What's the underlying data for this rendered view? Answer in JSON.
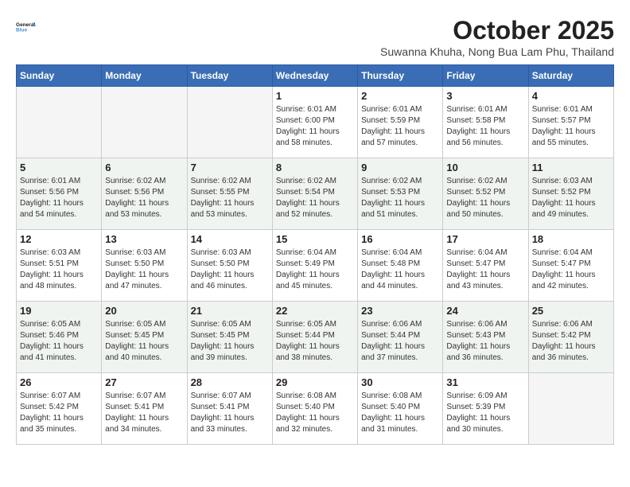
{
  "logo": {
    "line1": "General",
    "line2": "Blue"
  },
  "title": "October 2025",
  "subtitle": "Suwanna Khuha, Nong Bua Lam Phu, Thailand",
  "weekdays": [
    "Sunday",
    "Monday",
    "Tuesday",
    "Wednesday",
    "Thursday",
    "Friday",
    "Saturday"
  ],
  "weeks": [
    [
      {
        "day": "",
        "info": ""
      },
      {
        "day": "",
        "info": ""
      },
      {
        "day": "",
        "info": ""
      },
      {
        "day": "1",
        "info": "Sunrise: 6:01 AM\nSunset: 6:00 PM\nDaylight: 11 hours and 58 minutes."
      },
      {
        "day": "2",
        "info": "Sunrise: 6:01 AM\nSunset: 5:59 PM\nDaylight: 11 hours and 57 minutes."
      },
      {
        "day": "3",
        "info": "Sunrise: 6:01 AM\nSunset: 5:58 PM\nDaylight: 11 hours and 56 minutes."
      },
      {
        "day": "4",
        "info": "Sunrise: 6:01 AM\nSunset: 5:57 PM\nDaylight: 11 hours and 55 minutes."
      }
    ],
    [
      {
        "day": "5",
        "info": "Sunrise: 6:01 AM\nSunset: 5:56 PM\nDaylight: 11 hours and 54 minutes."
      },
      {
        "day": "6",
        "info": "Sunrise: 6:02 AM\nSunset: 5:56 PM\nDaylight: 11 hours and 53 minutes."
      },
      {
        "day": "7",
        "info": "Sunrise: 6:02 AM\nSunset: 5:55 PM\nDaylight: 11 hours and 53 minutes."
      },
      {
        "day": "8",
        "info": "Sunrise: 6:02 AM\nSunset: 5:54 PM\nDaylight: 11 hours and 52 minutes."
      },
      {
        "day": "9",
        "info": "Sunrise: 6:02 AM\nSunset: 5:53 PM\nDaylight: 11 hours and 51 minutes."
      },
      {
        "day": "10",
        "info": "Sunrise: 6:02 AM\nSunset: 5:52 PM\nDaylight: 11 hours and 50 minutes."
      },
      {
        "day": "11",
        "info": "Sunrise: 6:03 AM\nSunset: 5:52 PM\nDaylight: 11 hours and 49 minutes."
      }
    ],
    [
      {
        "day": "12",
        "info": "Sunrise: 6:03 AM\nSunset: 5:51 PM\nDaylight: 11 hours and 48 minutes."
      },
      {
        "day": "13",
        "info": "Sunrise: 6:03 AM\nSunset: 5:50 PM\nDaylight: 11 hours and 47 minutes."
      },
      {
        "day": "14",
        "info": "Sunrise: 6:03 AM\nSunset: 5:50 PM\nDaylight: 11 hours and 46 minutes."
      },
      {
        "day": "15",
        "info": "Sunrise: 6:04 AM\nSunset: 5:49 PM\nDaylight: 11 hours and 45 minutes."
      },
      {
        "day": "16",
        "info": "Sunrise: 6:04 AM\nSunset: 5:48 PM\nDaylight: 11 hours and 44 minutes."
      },
      {
        "day": "17",
        "info": "Sunrise: 6:04 AM\nSunset: 5:47 PM\nDaylight: 11 hours and 43 minutes."
      },
      {
        "day": "18",
        "info": "Sunrise: 6:04 AM\nSunset: 5:47 PM\nDaylight: 11 hours and 42 minutes."
      }
    ],
    [
      {
        "day": "19",
        "info": "Sunrise: 6:05 AM\nSunset: 5:46 PM\nDaylight: 11 hours and 41 minutes."
      },
      {
        "day": "20",
        "info": "Sunrise: 6:05 AM\nSunset: 5:45 PM\nDaylight: 11 hours and 40 minutes."
      },
      {
        "day": "21",
        "info": "Sunrise: 6:05 AM\nSunset: 5:45 PM\nDaylight: 11 hours and 39 minutes."
      },
      {
        "day": "22",
        "info": "Sunrise: 6:05 AM\nSunset: 5:44 PM\nDaylight: 11 hours and 38 minutes."
      },
      {
        "day": "23",
        "info": "Sunrise: 6:06 AM\nSunset: 5:44 PM\nDaylight: 11 hours and 37 minutes."
      },
      {
        "day": "24",
        "info": "Sunrise: 6:06 AM\nSunset: 5:43 PM\nDaylight: 11 hours and 36 minutes."
      },
      {
        "day": "25",
        "info": "Sunrise: 6:06 AM\nSunset: 5:42 PM\nDaylight: 11 hours and 36 minutes."
      }
    ],
    [
      {
        "day": "26",
        "info": "Sunrise: 6:07 AM\nSunset: 5:42 PM\nDaylight: 11 hours and 35 minutes."
      },
      {
        "day": "27",
        "info": "Sunrise: 6:07 AM\nSunset: 5:41 PM\nDaylight: 11 hours and 34 minutes."
      },
      {
        "day": "28",
        "info": "Sunrise: 6:07 AM\nSunset: 5:41 PM\nDaylight: 11 hours and 33 minutes."
      },
      {
        "day": "29",
        "info": "Sunrise: 6:08 AM\nSunset: 5:40 PM\nDaylight: 11 hours and 32 minutes."
      },
      {
        "day": "30",
        "info": "Sunrise: 6:08 AM\nSunset: 5:40 PM\nDaylight: 11 hours and 31 minutes."
      },
      {
        "day": "31",
        "info": "Sunrise: 6:09 AM\nSunset: 5:39 PM\nDaylight: 11 hours and 30 minutes."
      },
      {
        "day": "",
        "info": ""
      }
    ]
  ]
}
